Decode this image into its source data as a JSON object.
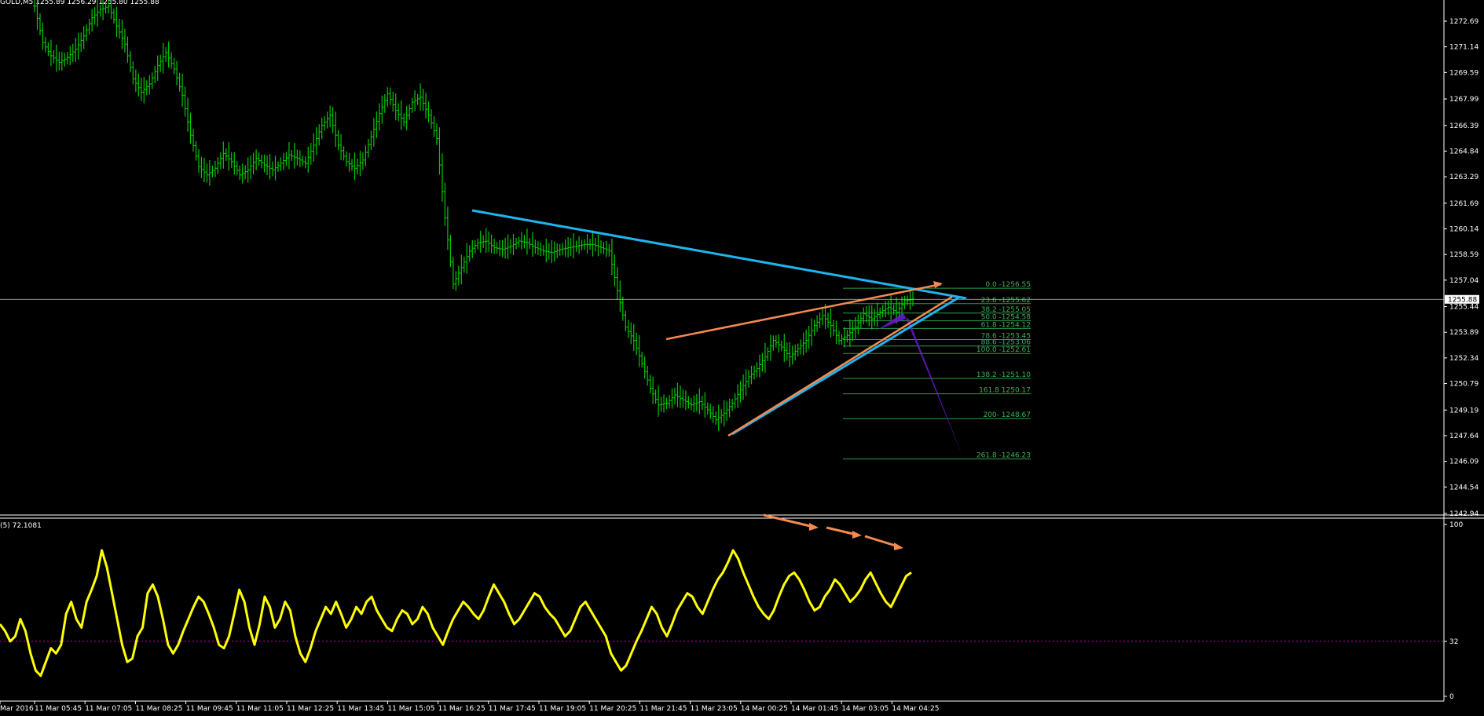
{
  "window": {
    "title": "GOLD,M5",
    "ohlc": "1255.89 1256.29 1255.80 1255.88",
    "indicator_label": "(5) 72.1081"
  },
  "chart_data": [
    {
      "type": "line",
      "name": "price",
      "y_ticks": [
        "1272.69",
        "1271.14",
        "1269.59",
        "1267.99",
        "1266.39",
        "1264.84",
        "1263.29",
        "1261.69",
        "1260.14",
        "1258.59",
        "1257.04",
        "1255.44",
        "1253.89",
        "1252.34",
        "1250.79",
        "1249.19",
        "1247.64",
        "1246.09",
        "1244.54",
        "1242.94"
      ],
      "ylim": [
        1242.94,
        1273.5
      ],
      "current_price": "1255.88",
      "candle_color": "#00c800",
      "close": [
        1273.6,
        1271.4,
        1270.6,
        1270.2,
        1270.5,
        1271.0,
        1271.8,
        1272.9,
        1273.4,
        1273.6,
        1272.4,
        1271.3,
        1269.2,
        1268.4,
        1268.9,
        1270.0,
        1270.8,
        1269.8,
        1268.2,
        1265.8,
        1263.9,
        1263.4,
        1263.8,
        1264.7,
        1264.2,
        1263.4,
        1263.7,
        1264.4,
        1264.0,
        1263.7,
        1264.1,
        1264.6,
        1264.4,
        1264.1,
        1265.2,
        1266.4,
        1267.0,
        1265.2,
        1264.2,
        1263.8,
        1264.3,
        1265.7,
        1267.1,
        1268.3,
        1267.3,
        1266.6,
        1267.8,
        1268.1,
        1267.0,
        1265.6,
        1260.8,
        1256.8,
        1257.8,
        1258.8,
        1259.3,
        1259.4,
        1259.0,
        1258.9,
        1259.1,
        1259.4,
        1259.3,
        1259.0,
        1258.8,
        1258.7,
        1258.9,
        1259.0,
        1259.1,
        1259.2,
        1259.2,
        1259.0,
        1258.8,
        1256.4,
        1254.2,
        1253.4,
        1252.0,
        1250.5,
        1249.5,
        1249.6,
        1250.1,
        1249.8,
        1249.5,
        1249.7,
        1249.2,
        1248.6,
        1249.0,
        1249.6,
        1250.4,
        1251.2,
        1251.7,
        1252.4,
        1253.4,
        1253.0,
        1252.4,
        1252.9,
        1253.4,
        1254.3,
        1254.9,
        1254.3,
        1253.4,
        1253.7,
        1254.2,
        1255.0,
        1254.7,
        1255.1,
        1255.4,
        1255.1,
        1255.8,
        1255.9
      ],
      "annotations": {
        "upper_trendline": {
          "color": "#1fb4ee",
          "from": [
            1261.2,
            0.319
          ],
          "to": [
            1255.9,
            0.65
          ]
        },
        "lower_trendline": {
          "color": "#1fb4ee",
          "from": [
            1247.8,
            0.494
          ],
          "to": [
            1256.0,
            0.646
          ]
        },
        "orange_upper": {
          "color": "#f58a50"
        },
        "orange_lower": {
          "color": "#f58a50"
        }
      },
      "fibonacci": {
        "color": "#2e9e4a",
        "levels": [
          {
            "label": "0.0 -1256.55",
            "price": 1256.55
          },
          {
            "label": "23.6 -1255.62",
            "price": 1255.62
          },
          {
            "label": "38.2 -1255.05",
            "price": 1255.05
          },
          {
            "label": "50.0 -1254.58",
            "price": 1254.58
          },
          {
            "label": "61.8 -1254.12",
            "price": 1254.12
          },
          {
            "label": "78.6 -1253.45",
            "price": 1253.45
          },
          {
            "label": "88.6 -1253.06",
            "price": 1253.06
          },
          {
            "label": "100.0 -1252.61",
            "price": 1252.61
          },
          {
            "label": "138.2 -1251.10",
            "price": 1251.1
          },
          {
            "label": "161.8 1250.17",
            "price": 1250.17
          },
          {
            "label": "200- 1248.67",
            "price": 1248.67
          },
          {
            "label": "261.8 -1246.23",
            "price": 1246.23
          }
        ]
      }
    },
    {
      "type": "line",
      "name": "oscillator",
      "y_ticks": [
        "100",
        "32",
        "0"
      ],
      "ylim": [
        0,
        100
      ],
      "level": 32,
      "color": "#ffff00",
      "values": [
        42,
        38,
        32,
        35,
        45,
        38,
        25,
        15,
        12,
        20,
        28,
        25,
        30,
        48,
        55,
        45,
        40,
        55,
        62,
        70,
        85,
        75,
        60,
        45,
        30,
        20,
        22,
        35,
        40,
        60,
        65,
        58,
        45,
        30,
        25,
        30,
        38,
        45,
        52,
        58,
        55,
        48,
        40,
        30,
        28,
        35,
        48,
        62,
        55,
        40,
        30,
        42,
        58,
        52,
        40,
        45,
        55,
        50,
        35,
        25,
        20,
        28,
        38,
        45,
        52,
        48,
        55,
        48,
        40,
        45,
        52,
        48,
        55,
        58,
        50,
        45,
        40,
        38,
        45,
        50,
        48,
        42,
        45,
        52,
        48,
        40,
        35,
        30,
        38,
        45,
        50,
        55,
        52,
        48,
        45,
        50,
        58,
        65,
        60,
        55,
        48,
        42,
        45,
        50,
        55,
        60,
        58,
        52,
        48,
        45,
        40,
        35,
        38,
        45,
        52,
        55,
        50,
        45,
        40,
        35,
        25,
        20,
        15,
        18,
        25,
        32,
        38,
        45,
        52,
        48,
        40,
        35,
        42,
        50,
        55,
        60,
        58,
        52,
        48,
        55,
        62,
        68,
        72,
        78,
        85,
        80,
        72,
        65,
        58,
        52,
        48,
        45,
        50,
        58,
        65,
        70,
        72,
        68,
        62,
        55,
        50,
        52,
        58,
        62,
        68,
        65,
        60,
        55,
        58,
        62,
        68,
        72,
        66,
        60,
        55,
        52,
        58,
        64,
        70,
        72
      ],
      "annotation_color": "#f58a50"
    }
  ],
  "x_axis": {
    "labels": [
      "Mar 2016",
      "11 Mar 05:45",
      "11 Mar 07:05",
      "11 Mar 08:25",
      "11 Mar 09:45",
      "11 Mar 11:05",
      "11 Mar 12:25",
      "11 Mar 13:45",
      "11 Mar 15:05",
      "11 Mar 16:25",
      "11 Mar 17:45",
      "11 Mar 19:05",
      "11 Mar 20:25",
      "11 Mar 21:45",
      "11 Mar 23:05",
      "14 Mar 00:25",
      "14 Mar 01:45",
      "14 Mar 03:05",
      "14 Mar 04:25"
    ]
  }
}
